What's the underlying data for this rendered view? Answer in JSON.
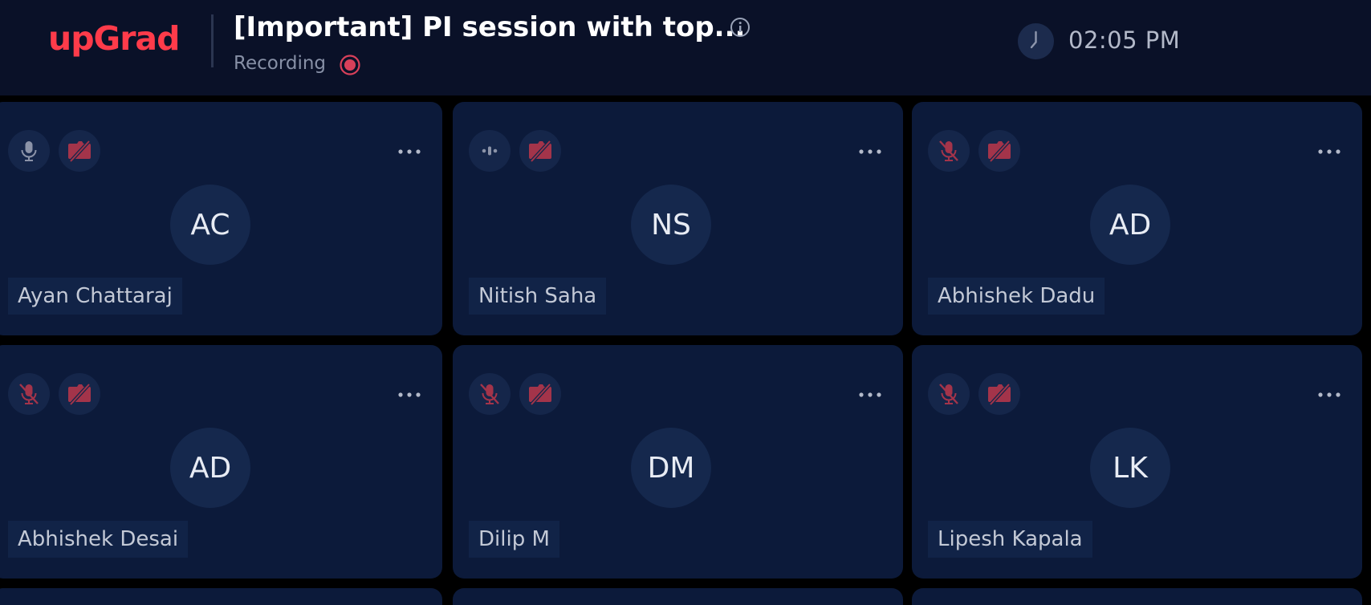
{
  "header": {
    "brand": "upGrad",
    "title": "[Important] PI session with top...",
    "status": "Recording",
    "time": "02:05 PM",
    "icons": {
      "info": "info-icon",
      "recording": "record-icon",
      "clock": "clock-icon"
    }
  },
  "colors": {
    "brand": "#ff3b4a",
    "header_bg": "#0a1128",
    "tile_bg": "#0c1a3a",
    "muted_red": "#a3344a"
  },
  "participants": [
    {
      "initials": "AC",
      "name": "Ayan Chattaraj",
      "mic": "on",
      "camera": "off"
    },
    {
      "initials": "NS",
      "name": "Nitish Saha",
      "mic": "speaking",
      "camera": "off"
    },
    {
      "initials": "AD",
      "name": "Abhishek Dadu",
      "mic": "muted",
      "camera": "off"
    },
    {
      "initials": "AD",
      "name": "Abhishek Desai",
      "mic": "muted",
      "camera": "off"
    },
    {
      "initials": "DM",
      "name": "Dilip M",
      "mic": "muted",
      "camera": "off"
    },
    {
      "initials": "LK",
      "name": "Lipesh Kapala",
      "mic": "muted",
      "camera": "off"
    }
  ]
}
